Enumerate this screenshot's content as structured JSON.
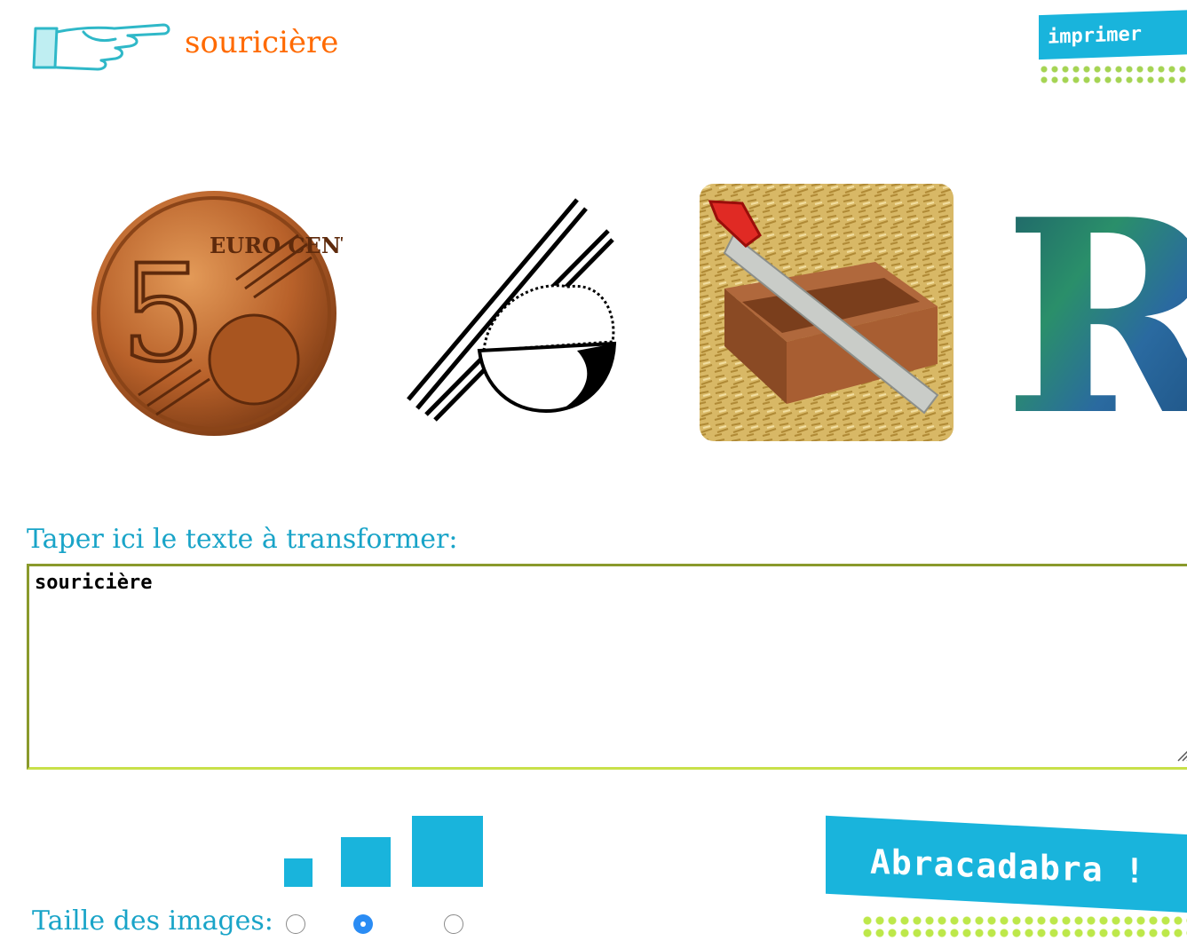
{
  "header": {
    "title": "souricière",
    "print_label": "imprimer"
  },
  "images": [
    {
      "name": "euro-5-cent-coin",
      "icon": "coin-5-cent-icon",
      "text": "EURO CENT",
      "numeral": "5"
    },
    {
      "name": "rice-bowl-chopsticks",
      "icon": "rice-bowl-icon"
    },
    {
      "name": "miter-box-saw",
      "icon": "saw-icon"
    },
    {
      "name": "letter-r",
      "icon": "letter-r-icon",
      "glyph": "R"
    }
  ],
  "editor": {
    "label": "Taper ici le texte à transformer:",
    "value": "souricière"
  },
  "size_picker": {
    "label": "Taille des images:",
    "options": [
      "small",
      "medium",
      "large"
    ],
    "selected": "medium"
  },
  "action": {
    "label": "Abracadabra !"
  },
  "colors": {
    "accent_blue": "#19b4dc",
    "title_orange": "#ff6a00",
    "label_teal": "#19a4c8",
    "border_olive": "#8a9a2c",
    "dots_green": "#9bcf40",
    "radio_selected": "#2a8cf4"
  }
}
